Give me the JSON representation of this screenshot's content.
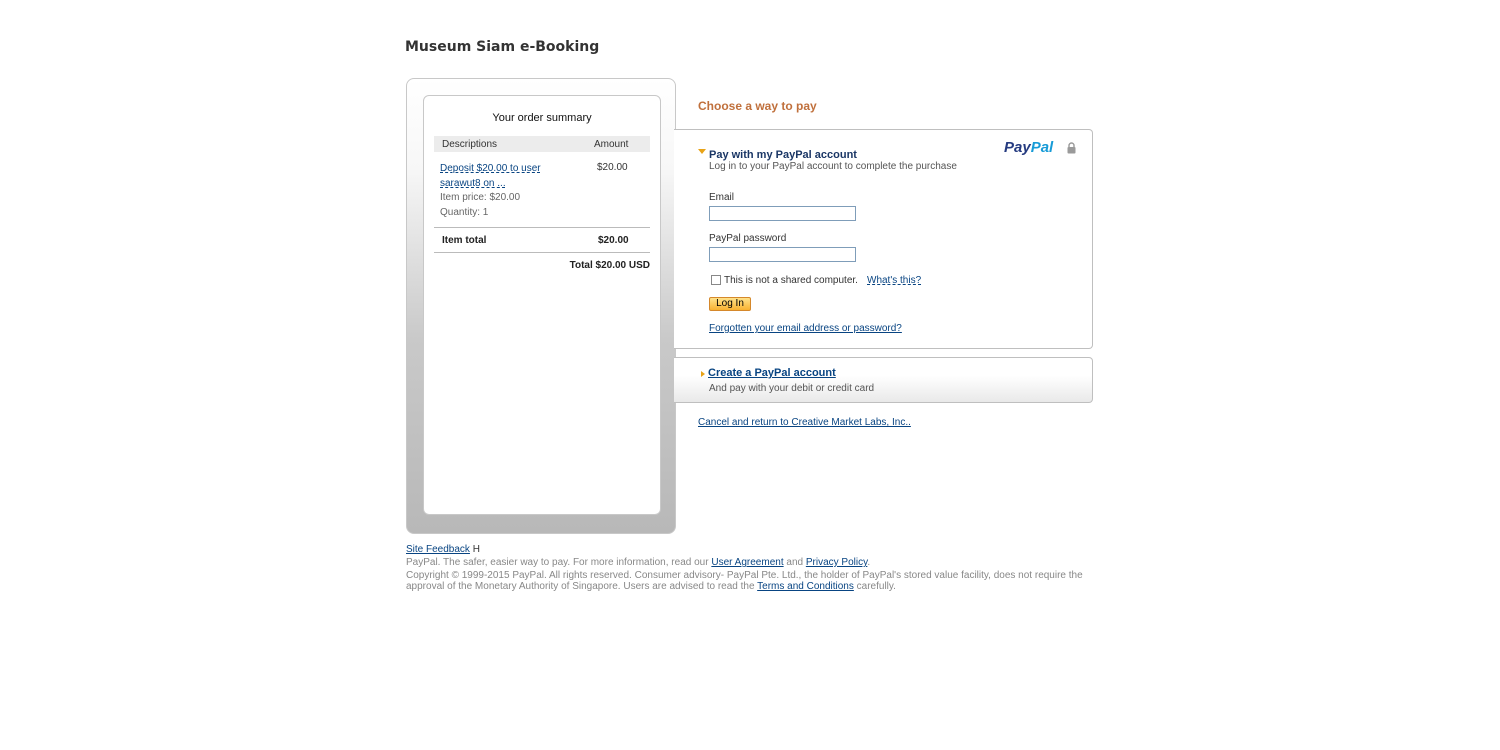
{
  "merchant": {
    "title": "Museum Siam e-Booking"
  },
  "summary": {
    "heading": "Your order summary",
    "col_desc": "Descriptions",
    "col_amount": "Amount",
    "item": {
      "description": "Deposit $20.00 to user sarawut8 on ...",
      "amount": "$20.00",
      "item_price": "Item price: $20.00",
      "quantity": "Quantity: 1"
    },
    "item_total_label": "Item total",
    "item_total_value": "$20.00",
    "total": "Total $20.00 USD"
  },
  "payment": {
    "choose_heading": "Choose a way to pay",
    "login": {
      "title": "Pay with my PayPal account",
      "subtitle": "Log in to your PayPal account to complete the purchase",
      "logo_pay": "Pay",
      "logo_pal": "Pal",
      "email_label": "Email",
      "email_value": "",
      "password_label": "PayPal password",
      "password_value": "",
      "shared_label": "This is not a shared computer.",
      "whats_this": "What's this?",
      "login_button": "Log In",
      "forgot": "Forgotten your email address or password?"
    },
    "create": {
      "link": "Create a PayPal account",
      "subtitle": "And pay with your debit or credit card"
    },
    "cancel": "Cancel and return to Creative Market Labs, Inc.."
  },
  "footer": {
    "site_feedback": "Site Feedback",
    "feedback_suffix": "H",
    "tagline_prefix": "PayPal. The safer, easier way to pay. For more information, read our",
    "user_agreement": "User Agreement",
    "and": "and",
    "privacy_policy": "Privacy Policy",
    "period": ".",
    "copyright_prefix": "Copyright © 1999-2015 PayPal. All rights reserved. Consumer advisory- PayPal Pte. Ltd., the holder of PayPal's stored value facility, does not require the approval of the Monetary Authority of Singapore. Users are advised to read the",
    "terms": "Terms and Conditions",
    "copyright_suffix": "carefully."
  },
  "colors": {
    "accent_orange": "#c0703c",
    "link_blue": "#084482",
    "paypal_dark_blue": "#253b80",
    "paypal_light_blue": "#179bd7",
    "button_yellow": "#f9b231"
  },
  "icons": [
    "lock-icon",
    "triangle-down-icon",
    "triangle-right-icon",
    "paypal-logo"
  ]
}
